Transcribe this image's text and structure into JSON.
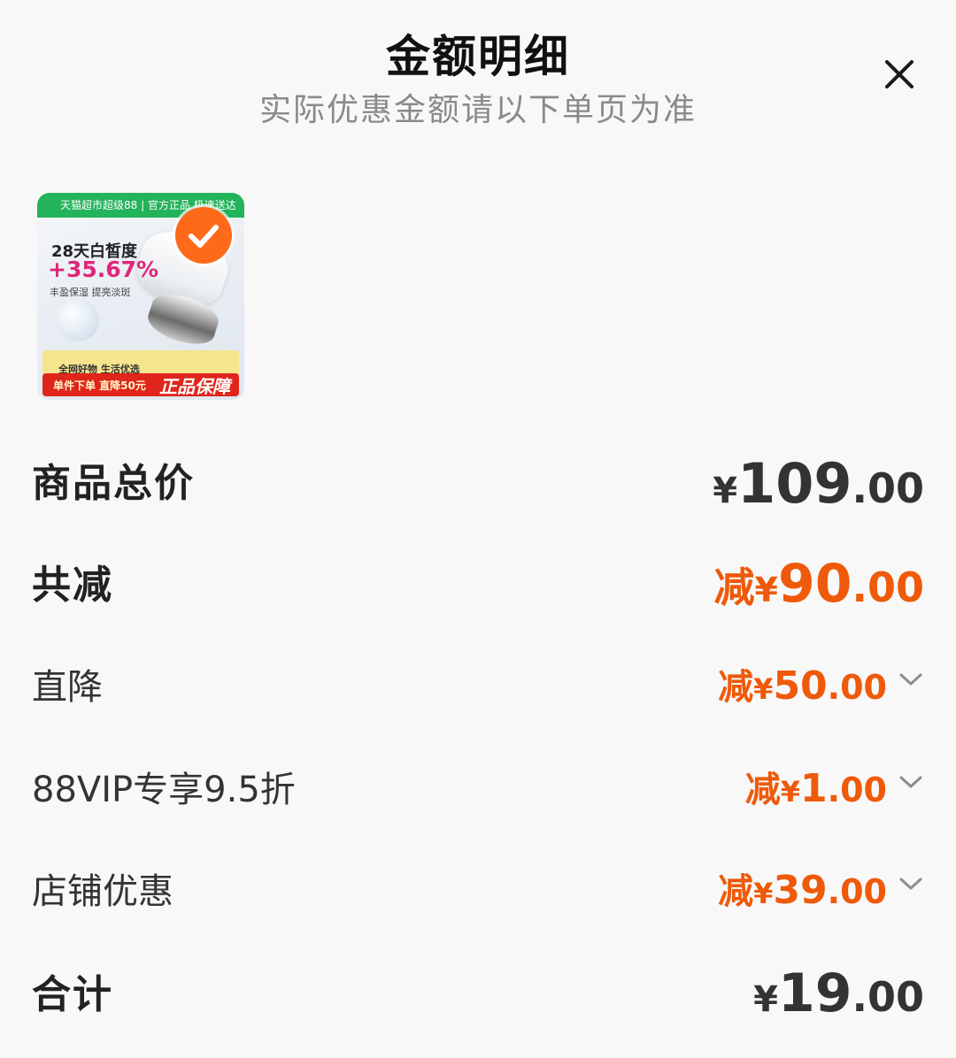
{
  "header": {
    "title": "金额明细",
    "subtitle": "实际优惠金额请以下单页为准"
  },
  "product_image": {
    "top_band": "天猫超市超级88 | 官方正品 极速送达",
    "headline": "28天白皙度",
    "percent": "+35.67%",
    "sub": "丰盈保湿  提亮淡斑",
    "mid_band": "全网好物 生活优选",
    "bottom_band": "单件下单 直降50元",
    "bottom_big": "正品保障",
    "selected": true
  },
  "rows": {
    "total": {
      "label": "商品总价",
      "symbol": "¥",
      "integer": "109",
      "decimal": ".00"
    },
    "reduce": {
      "label": "共减",
      "prefix": "减",
      "symbol": "¥",
      "integer": "90",
      "decimal": ".00"
    },
    "direct": {
      "label": "直降",
      "prefix": "减",
      "symbol": "¥",
      "integer": "50",
      "decimal": ".00"
    },
    "vip": {
      "label": "88VIP专享9.5折",
      "prefix": "减",
      "symbol": "¥",
      "integer": "1",
      "decimal": ".00"
    },
    "shop": {
      "label": "店铺优惠",
      "prefix": "减",
      "symbol": "¥",
      "integer": "39",
      "decimal": ".00"
    },
    "sum": {
      "label": "合计",
      "symbol": "¥",
      "integer": "19",
      "decimal": ".00"
    }
  },
  "colors": {
    "accent": "#ee5a0a",
    "badge": "#ff6a1a",
    "text": "#222222",
    "muted": "#8a8a8a"
  }
}
